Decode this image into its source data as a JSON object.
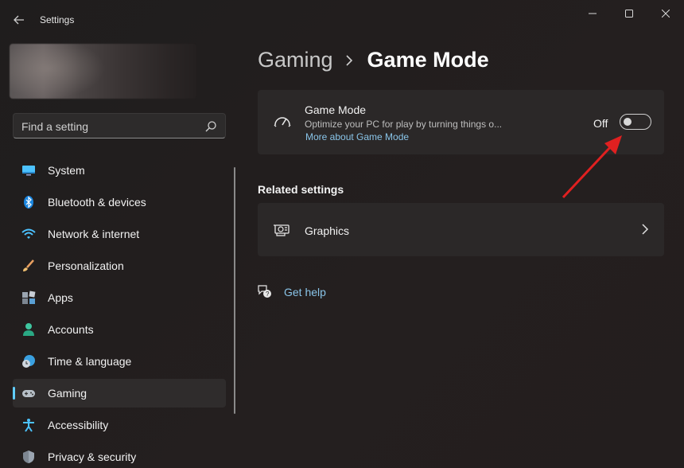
{
  "window": {
    "title": "Settings",
    "controls": [
      "minimize",
      "maximize",
      "close"
    ]
  },
  "search": {
    "placeholder": "Find a setting"
  },
  "sidebar": {
    "items": [
      {
        "label": "System",
        "icon": "system-icon",
        "selected": false
      },
      {
        "label": "Bluetooth & devices",
        "icon": "bluetooth-icon",
        "selected": false
      },
      {
        "label": "Network & internet",
        "icon": "wifi-icon",
        "selected": false
      },
      {
        "label": "Personalization",
        "icon": "brush-icon",
        "selected": false
      },
      {
        "label": "Apps",
        "icon": "apps-icon",
        "selected": false
      },
      {
        "label": "Accounts",
        "icon": "person-icon",
        "selected": false
      },
      {
        "label": "Time & language",
        "icon": "clock-globe-icon",
        "selected": false
      },
      {
        "label": "Gaming",
        "icon": "gamepad-icon",
        "selected": true
      },
      {
        "label": "Accessibility",
        "icon": "accessibility-icon",
        "selected": false
      },
      {
        "label": "Privacy & security",
        "icon": "shield-icon",
        "selected": false
      }
    ]
  },
  "breadcrumb": {
    "parent": "Gaming",
    "current": "Game Mode"
  },
  "game_mode": {
    "title": "Game Mode",
    "description": "Optimize your PC for play by turning things o...",
    "link": "More about Game Mode",
    "toggle_label": "Off",
    "toggle_on": false
  },
  "related": {
    "heading": "Related settings",
    "items": [
      {
        "label": "Graphics",
        "icon": "graphics-card-icon"
      }
    ]
  },
  "help": {
    "label": "Get help"
  },
  "colors": {
    "accent": "#60cdff",
    "link": "#89c4e8",
    "annotation_arrow": "#e02020"
  }
}
